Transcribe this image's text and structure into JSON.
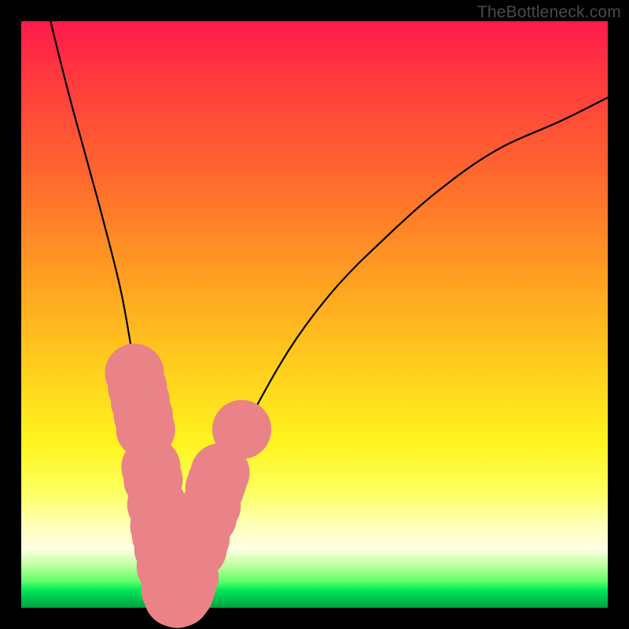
{
  "watermark": "TheBottleneck.com",
  "chart_data": {
    "type": "line",
    "title": "",
    "xlabel": "",
    "ylabel": "",
    "xlim": [
      0,
      100
    ],
    "ylim": [
      0,
      100
    ],
    "note": "Bottleneck calculator curve; y = bottleneck percentage, x = relative component scale. Background gradient encodes bottleneck severity (red high, green low). Values estimated from pixels (axes unlabeled).",
    "series": [
      {
        "name": "bottleneck-curve",
        "x": [
          5,
          8,
          11,
          14,
          17,
          19,
          21,
          22.5,
          24,
          25.5,
          27,
          29,
          32,
          36,
          41,
          47,
          54,
          62,
          71,
          81,
          92,
          100
        ],
        "values": [
          100,
          88,
          77,
          66,
          54,
          43,
          33,
          23,
          12,
          3,
          2,
          7,
          16,
          26,
          36,
          46,
          55,
          63,
          71,
          78,
          83,
          87
        ]
      }
    ],
    "markers": {
      "name": "highlighted-points",
      "color": "#e98387",
      "points": [
        {
          "x": 19.3,
          "y": 40.0,
          "r": 1.4
        },
        {
          "x": 19.8,
          "y": 37.6,
          "r": 1.4
        },
        {
          "x": 20.3,
          "y": 35.2,
          "r": 1.4
        },
        {
          "x": 20.8,
          "y": 32.8,
          "r": 1.4
        },
        {
          "x": 21.2,
          "y": 30.4,
          "r": 1.4
        },
        {
          "x": 22.1,
          "y": 24.0,
          "r": 1.4
        },
        {
          "x": 22.5,
          "y": 21.8,
          "r": 1.4
        },
        {
          "x": 23.1,
          "y": 17.6,
          "r": 1.4
        },
        {
          "x": 23.6,
          "y": 14.0,
          "r": 1.4
        },
        {
          "x": 23.9,
          "y": 12.4,
          "r": 1.4
        },
        {
          "x": 24.3,
          "y": 10.0,
          "r": 1.4
        },
        {
          "x": 24.7,
          "y": 7.0,
          "r": 1.4
        },
        {
          "x": 25.5,
          "y": 3.0,
          "r": 1.4
        },
        {
          "x": 26.0,
          "y": 1.8,
          "r": 1.4
        },
        {
          "x": 26.6,
          "y": 1.6,
          "r": 1.4
        },
        {
          "x": 27.2,
          "y": 1.8,
          "r": 1.4
        },
        {
          "x": 27.8,
          "y": 2.6,
          "r": 1.4
        },
        {
          "x": 28.2,
          "y": 4.0,
          "r": 1.4
        },
        {
          "x": 28.6,
          "y": 5.2,
          "r": 1.4
        },
        {
          "x": 30.0,
          "y": 10.0,
          "r": 1.4
        },
        {
          "x": 30.5,
          "y": 11.8,
          "r": 1.4
        },
        {
          "x": 31.7,
          "y": 15.4,
          "r": 1.4
        },
        {
          "x": 32.4,
          "y": 17.4,
          "r": 1.4
        },
        {
          "x": 33.0,
          "y": 20.4,
          "r": 1.4
        },
        {
          "x": 33.4,
          "y": 21.6,
          "r": 1.4
        },
        {
          "x": 33.9,
          "y": 23.0,
          "r": 1.4
        },
        {
          "x": 37.6,
          "y": 30.4,
          "r": 1.4
        }
      ]
    },
    "gradient_stops": [
      {
        "pos": 0,
        "color": "#ff1a4a",
        "meaning": "severe bottleneck"
      },
      {
        "pos": 0.5,
        "color": "#ffd11d",
        "meaning": "moderate"
      },
      {
        "pos": 0.97,
        "color": "#00e85a",
        "meaning": "balanced"
      }
    ]
  }
}
